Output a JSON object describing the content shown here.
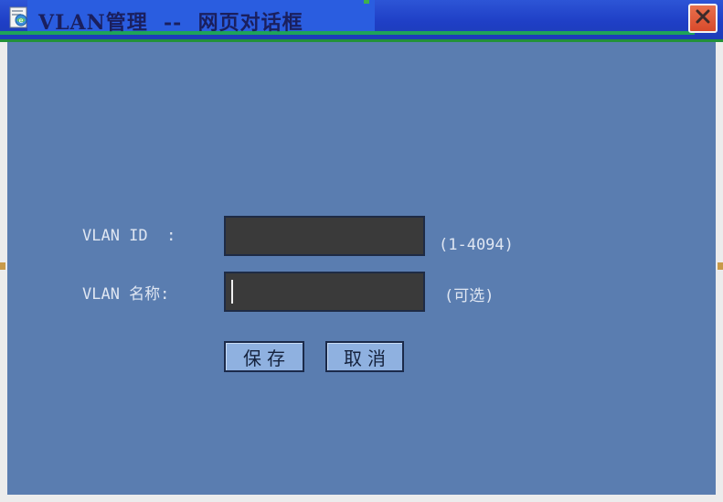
{
  "window": {
    "title": "VLAN管理  --  网页对话框"
  },
  "form": {
    "vlan_id_label": "VLAN ID  :",
    "vlan_id_value": "",
    "vlan_id_hint": "(1-4094)",
    "vlan_name_label": "VLAN 名称:",
    "vlan_name_value": "",
    "vlan_name_hint": "(可选)"
  },
  "buttons": {
    "save_label": "保存",
    "cancel_label": "取消"
  },
  "icons": {
    "title_icon": "web-page-dialog-icon",
    "close_icon": "close-icon"
  },
  "colors": {
    "title_bar": "#1f3fc6",
    "background": "#5a7db0",
    "field_bg": "#3a3a3a",
    "button_bg": "#8fb1e0",
    "close_button": "#d84a2b"
  }
}
